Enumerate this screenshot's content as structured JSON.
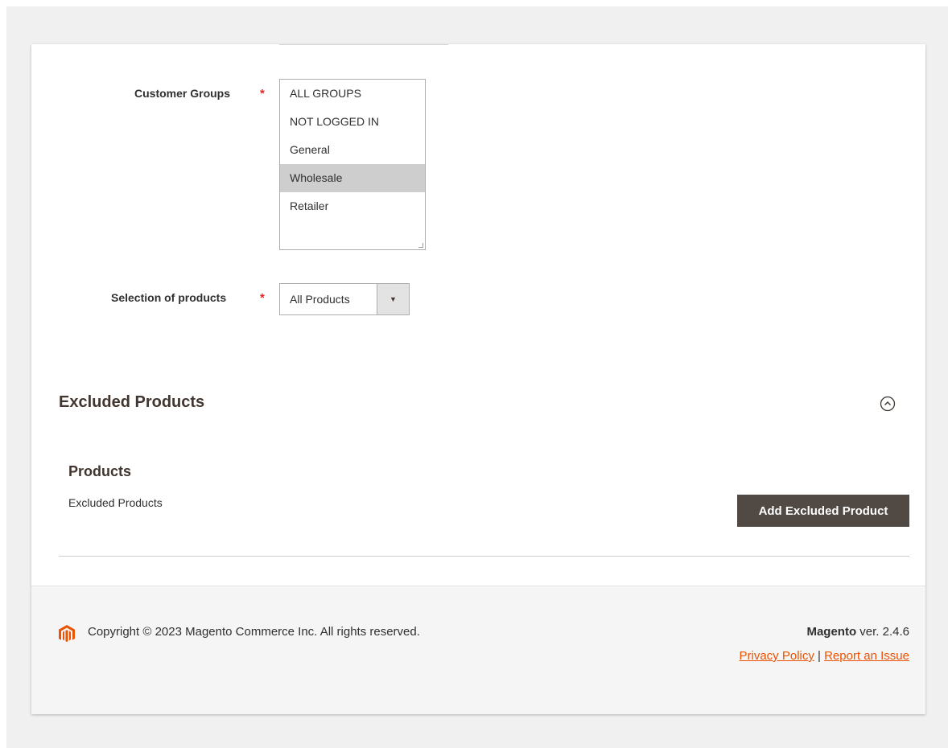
{
  "form": {
    "customer_groups": {
      "label": "Customer Groups",
      "required_mark": "*",
      "options": [
        {
          "label": "ALL GROUPS",
          "selected": false
        },
        {
          "label": "NOT LOGGED IN",
          "selected": false
        },
        {
          "label": "General",
          "selected": false
        },
        {
          "label": "Wholesale",
          "selected": true
        },
        {
          "label": "Retailer",
          "selected": false
        }
      ]
    },
    "selection_of_products": {
      "label": "Selection of products",
      "required_mark": "*",
      "value": "All Products",
      "arrow_icon": "caret-down-icon"
    }
  },
  "excluded_section": {
    "title": "Excluded Products",
    "collapse_icon": "chevron-up-circle-icon",
    "products_heading": "Products",
    "products_subtext": "Excluded Products",
    "add_button_label": "Add Excluded Product"
  },
  "footer": {
    "logo_icon": "magento-logo-icon",
    "copyright": "Copyright © 2023 Magento Commerce Inc. All rights reserved.",
    "brand": "Magento",
    "version": " ver. 2.4.6",
    "privacy_link": "Privacy Policy",
    "separator": " | ",
    "report_link": "Report an Issue"
  },
  "colors": {
    "accent_link": "#eb5202",
    "button_bg": "#514943",
    "required": "#e22626",
    "selected_option_bg": "#cecece"
  }
}
